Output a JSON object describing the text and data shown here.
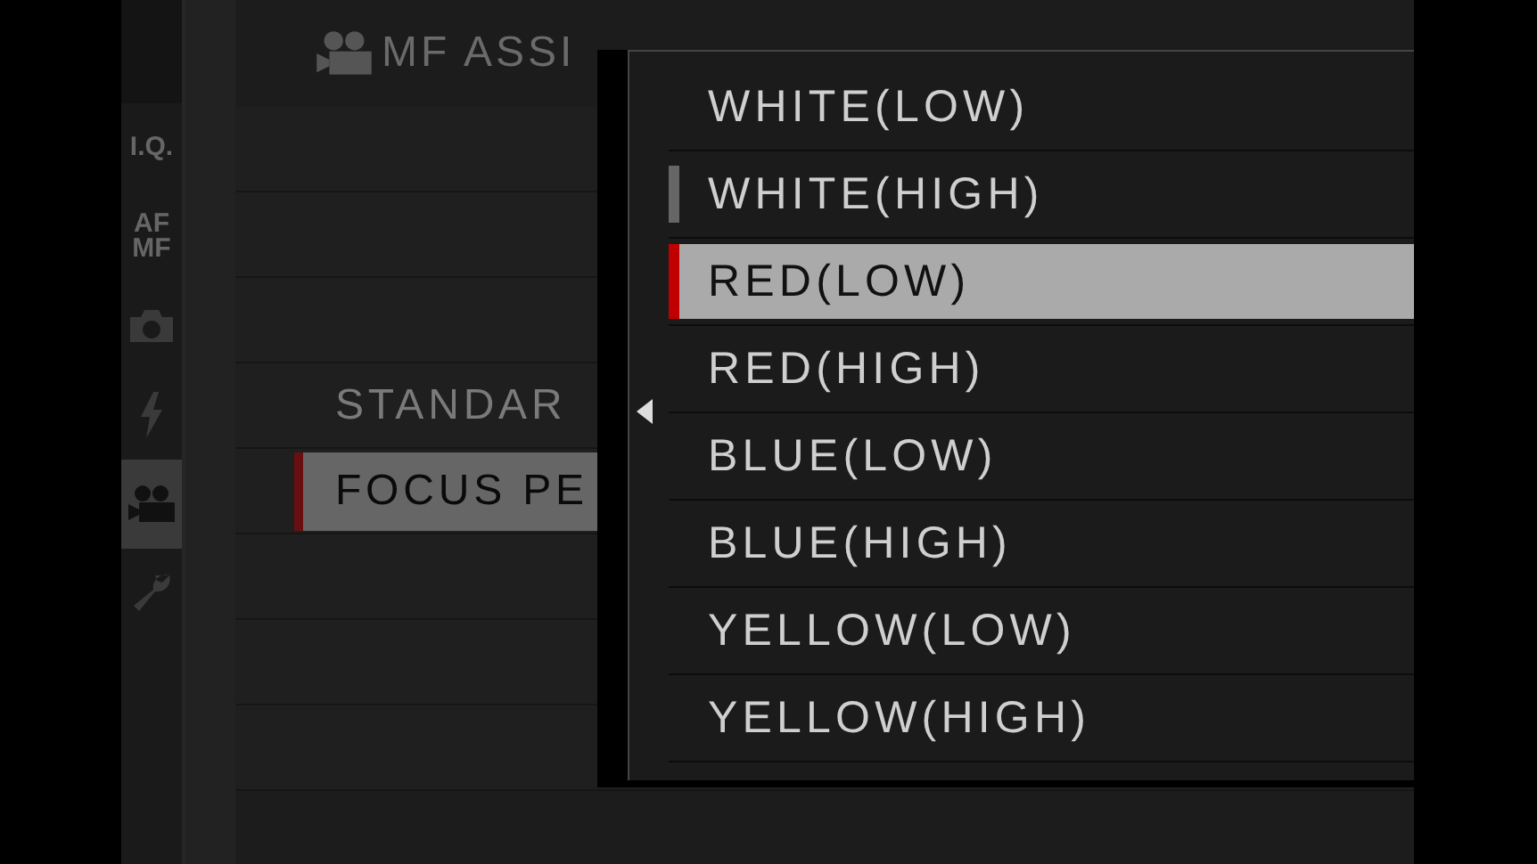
{
  "sidebar": {
    "tabs": [
      {
        "kind": "text",
        "label": "I.Q.",
        "selected": false
      },
      {
        "kind": "text",
        "label": "AF MF",
        "selected": false
      },
      {
        "kind": "camera",
        "selected": false
      },
      {
        "kind": "flash",
        "selected": false
      },
      {
        "kind": "movie",
        "selected": true
      },
      {
        "kind": "wrench",
        "selected": false
      }
    ]
  },
  "header": {
    "title": "MF ASSI"
  },
  "menu": {
    "rows": [
      {
        "selected": false
      },
      {
        "selected": false
      },
      {
        "selected": false
      },
      {
        "label": "STANDAR",
        "selected": false
      },
      {
        "label": "FOCUS PE",
        "selected": true
      },
      {
        "selected": false
      },
      {
        "selected": false
      },
      {
        "selected": false
      }
    ]
  },
  "popup": {
    "options": [
      {
        "label": "WHITE(LOW)",
        "selected": false,
        "current": false
      },
      {
        "label": "WHITE(HIGH)",
        "selected": false,
        "current": true
      },
      {
        "label": "RED(LOW)",
        "selected": true,
        "current": false
      },
      {
        "label": "RED(HIGH)",
        "selected": false,
        "current": false
      },
      {
        "label": "BLUE(LOW)",
        "selected": false,
        "current": false
      },
      {
        "label": "BLUE(HIGH)",
        "selected": false,
        "current": false
      },
      {
        "label": "YELLOW(LOW)",
        "selected": false,
        "current": false
      },
      {
        "label": "YELLOW(HIGH)",
        "selected": false,
        "current": false
      }
    ]
  }
}
